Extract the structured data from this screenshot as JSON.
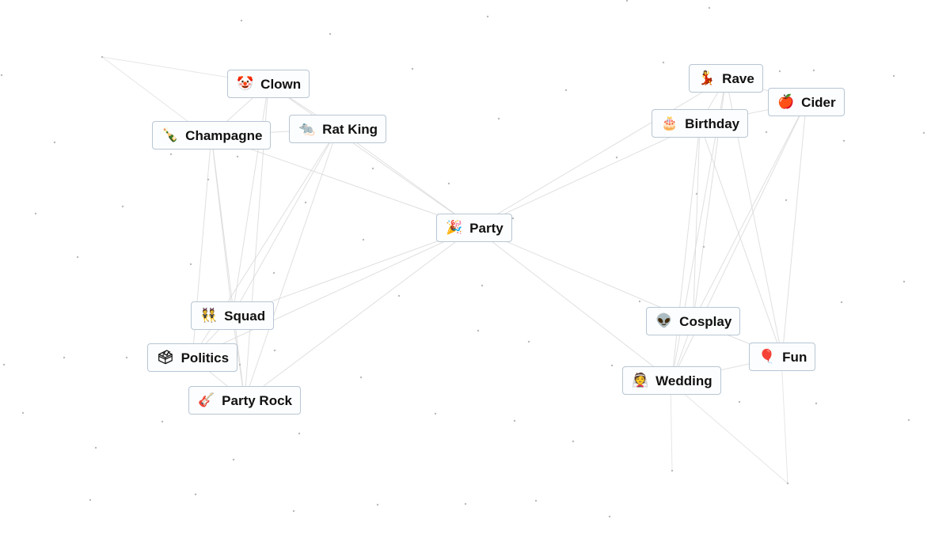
{
  "canvas": {
    "background": "#ffffff",
    "node_border": "#b7c6d4",
    "edge_color": "#d8d8d8",
    "dot_color": "#b9b9b9"
  },
  "elements": [
    {
      "id": "clown",
      "label": "Clown",
      "emoji": "🤡",
      "icon": "clown-icon"
    },
    {
      "id": "champagne",
      "label": "Champagne",
      "emoji": "🍾",
      "icon": "champagne-bottle-icon"
    },
    {
      "id": "rat-king",
      "label": "Rat King",
      "emoji": "🐀",
      "icon": "rat-icon"
    },
    {
      "id": "party",
      "label": "Party",
      "emoji": "🎉",
      "icon": "party-popper-icon"
    },
    {
      "id": "rave",
      "label": "Rave",
      "emoji": "💃",
      "icon": "dancer-icon"
    },
    {
      "id": "cider",
      "label": "Cider",
      "emoji": "🍎",
      "icon": "apple-icon"
    },
    {
      "id": "birthday",
      "label": "Birthday",
      "emoji": "🎂",
      "icon": "birthday-cake-icon"
    },
    {
      "id": "squad",
      "label": "Squad",
      "emoji": "👯",
      "icon": "people-group-icon"
    },
    {
      "id": "politics",
      "label": "Politics",
      "emoji": "🗳",
      "icon": "ballot-box-icon"
    },
    {
      "id": "party-rock",
      "label": "Party Rock",
      "emoji": "🎸",
      "icon": "guitar-icon"
    },
    {
      "id": "cosplay",
      "label": "Cosplay",
      "emoji": "👽",
      "icon": "alien-icon"
    },
    {
      "id": "fun",
      "label": "Fun",
      "emoji": "🎈",
      "icon": "balloon-icon"
    },
    {
      "id": "wedding",
      "label": "Wedding",
      "emoji": "👰",
      "icon": "bride-icon"
    }
  ],
  "connections": [
    [
      "clown",
      "champagne"
    ],
    [
      "clown",
      "rat-king"
    ],
    [
      "clown",
      "party"
    ],
    [
      "clown",
      "squad"
    ],
    [
      "clown",
      "party-rock"
    ],
    [
      "champagne",
      "rat-king"
    ],
    [
      "champagne",
      "party"
    ],
    [
      "champagne",
      "squad"
    ],
    [
      "champagne",
      "politics"
    ],
    [
      "champagne",
      "party-rock"
    ],
    [
      "rat-king",
      "party"
    ],
    [
      "rat-king",
      "squad"
    ],
    [
      "rat-king",
      "politics"
    ],
    [
      "rat-king",
      "party-rock"
    ],
    [
      "squad",
      "politics"
    ],
    [
      "squad",
      "party-rock"
    ],
    [
      "politics",
      "party-rock"
    ],
    [
      "squad",
      "party"
    ],
    [
      "politics",
      "party"
    ],
    [
      "party-rock",
      "party"
    ],
    [
      "party",
      "birthday"
    ],
    [
      "party",
      "rave"
    ],
    [
      "party",
      "cosplay"
    ],
    [
      "party",
      "wedding"
    ],
    [
      "rave",
      "cider"
    ],
    [
      "rave",
      "birthday"
    ],
    [
      "birthday",
      "cider"
    ],
    [
      "rave",
      "cosplay"
    ],
    [
      "rave",
      "wedding"
    ],
    [
      "rave",
      "fun"
    ],
    [
      "birthday",
      "cosplay"
    ],
    [
      "birthday",
      "wedding"
    ],
    [
      "birthday",
      "fun"
    ],
    [
      "cider",
      "cosplay"
    ],
    [
      "cider",
      "wedding"
    ],
    [
      "cider",
      "fun"
    ],
    [
      "cosplay",
      "fun"
    ],
    [
      "cosplay",
      "wedding"
    ],
    [
      "wedding",
      "fun"
    ]
  ]
}
